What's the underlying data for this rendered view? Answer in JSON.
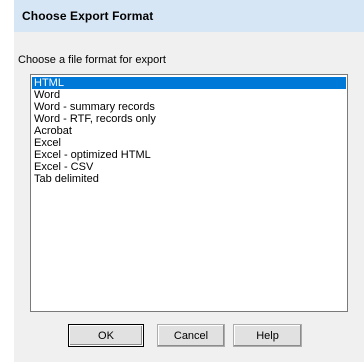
{
  "window": {
    "title": "Choose Export Format"
  },
  "prompt": "Choose a file format for export",
  "formats": [
    {
      "label": "HTML",
      "selected": true
    },
    {
      "label": "Word",
      "selected": false
    },
    {
      "label": "Word - summary records",
      "selected": false
    },
    {
      "label": "Word - RTF, records only",
      "selected": false
    },
    {
      "label": "Acrobat",
      "selected": false
    },
    {
      "label": "Excel",
      "selected": false
    },
    {
      "label": "Excel - optimized HTML",
      "selected": false
    },
    {
      "label": "Excel - CSV",
      "selected": false
    },
    {
      "label": "Tab delimited",
      "selected": false
    }
  ],
  "buttons": {
    "ok": "OK",
    "cancel": "Cancel",
    "help": "Help"
  },
  "colors": {
    "titlebar": "#d7e6f5",
    "selection": "#0078d7",
    "dialog_bg": "#f0f0f0"
  }
}
